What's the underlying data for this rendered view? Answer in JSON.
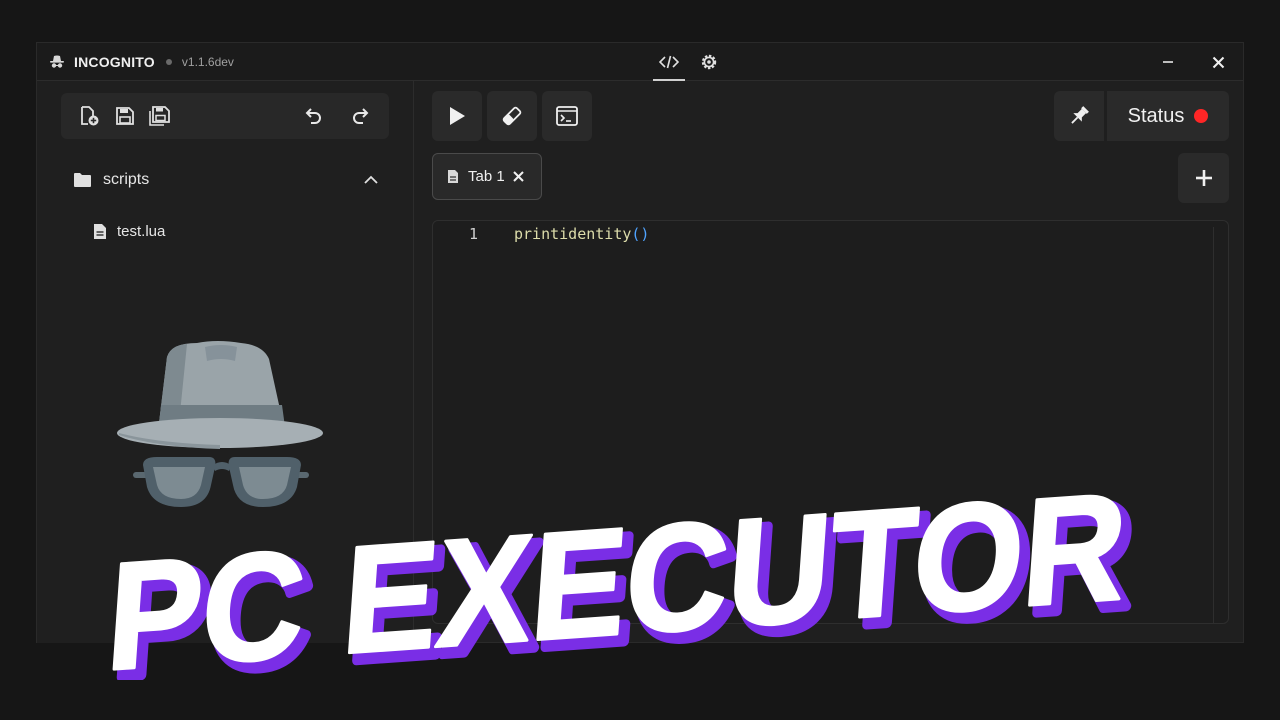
{
  "app": {
    "name": "INCOGNITO",
    "version": "v1.1.6dev"
  },
  "titlebar": {
    "tabs": [
      "code-view-icon",
      "settings-icon"
    ],
    "controls": [
      "minimize-icon",
      "close-icon"
    ]
  },
  "sidebar": {
    "toolbar": [
      "new-file-icon",
      "save-icon",
      "save-all-icon",
      "undo-icon",
      "redo-icon"
    ],
    "folder": {
      "label": "scripts",
      "expanded": true
    },
    "files": [
      {
        "label": "test.lua"
      }
    ]
  },
  "main": {
    "tools": [
      "run-icon",
      "clear-icon",
      "console-icon",
      "pin-icon"
    ],
    "status": {
      "label": "Status",
      "color": "#ff2626"
    },
    "tabs": [
      {
        "label": "Tab 1"
      }
    ],
    "editor": {
      "line_number": "1",
      "code_fn": "printidentity",
      "code_paren": "()"
    }
  },
  "banner": {
    "text": "PC EXECUTOR",
    "fill": "#ffffff",
    "shadow": "#7a2ee6"
  }
}
